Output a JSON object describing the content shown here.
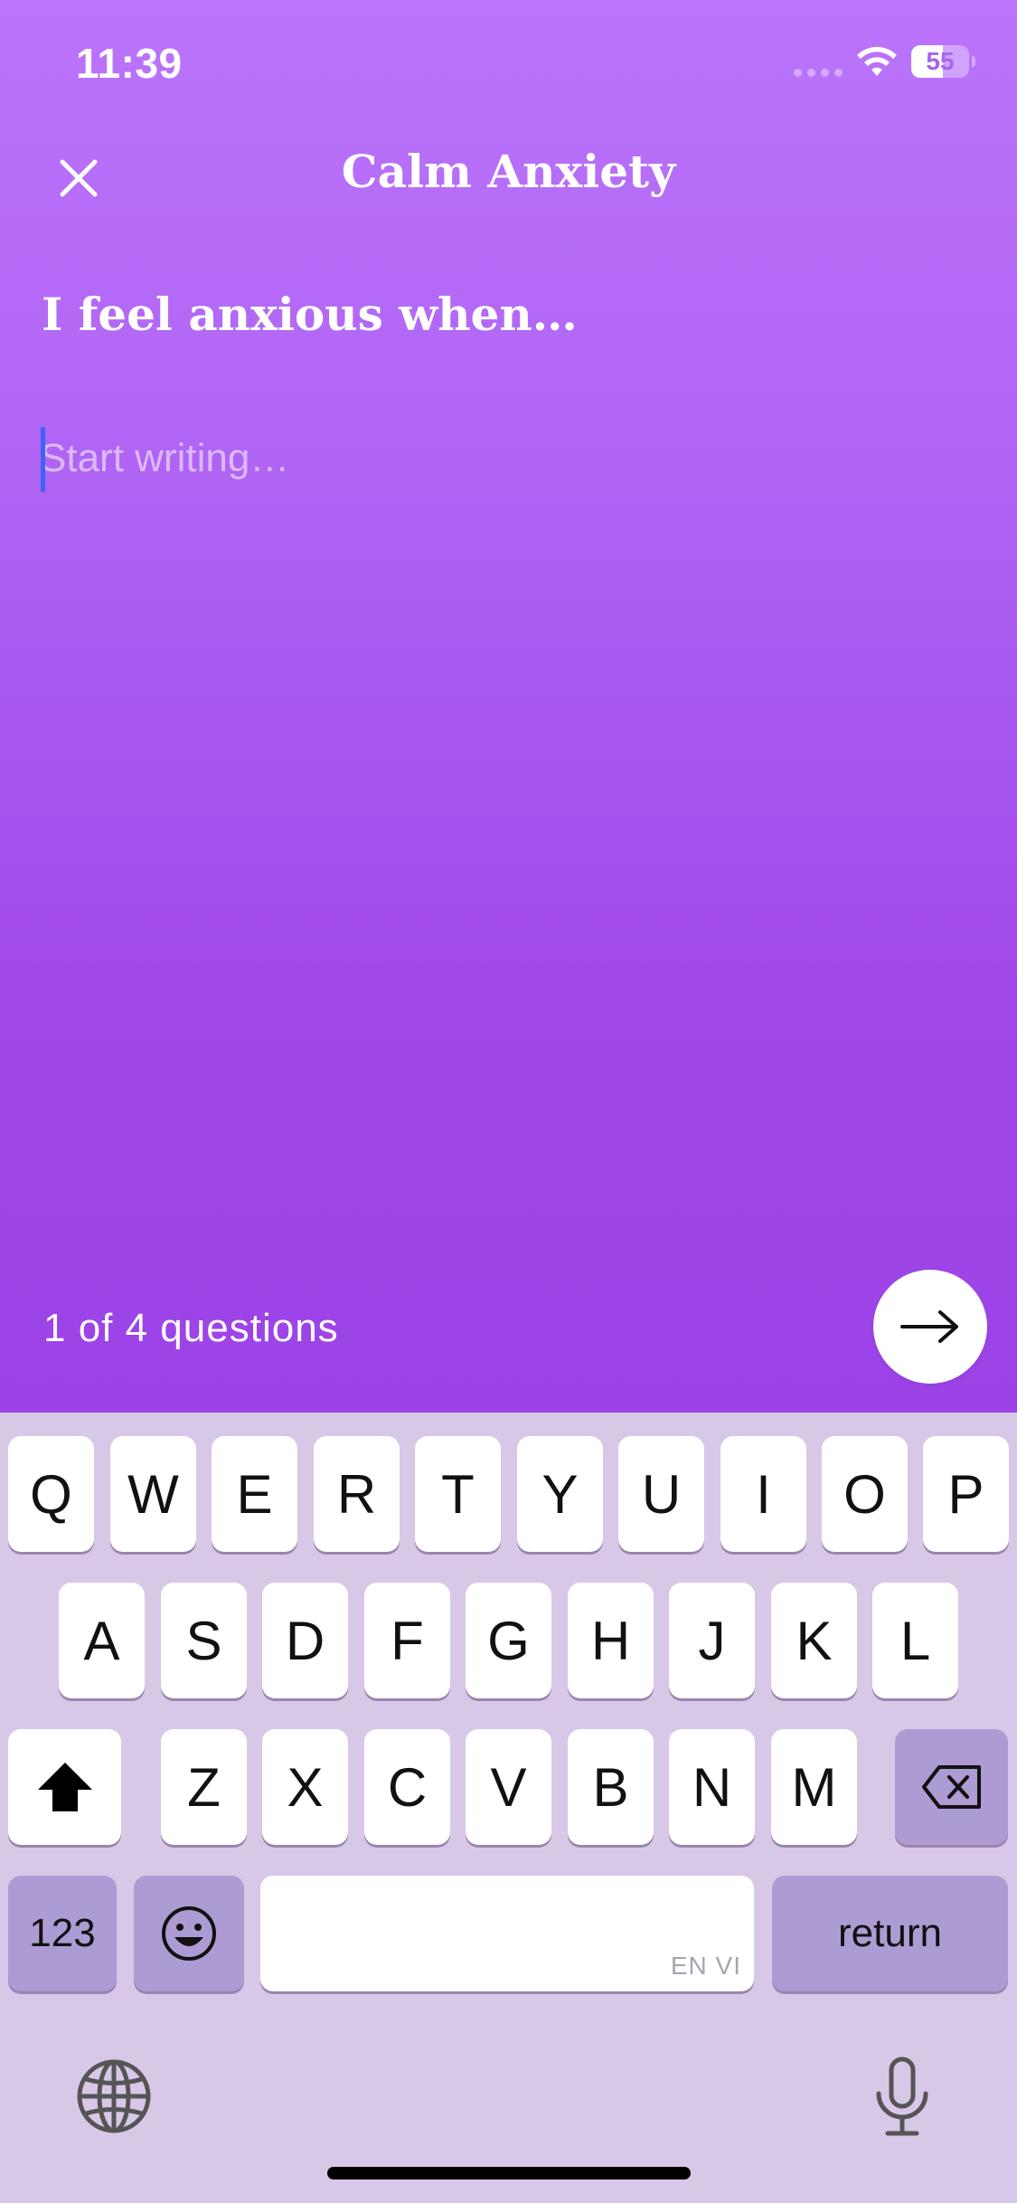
{
  "status_bar": {
    "time": "11:39",
    "battery": "55",
    "wifi_icon": "wifi-icon",
    "battery_icon": "battery-icon"
  },
  "header": {
    "title": "Calm Anxiety",
    "close_icon": "close-icon"
  },
  "prompt": "I feel anxious when…",
  "editor": {
    "placeholder": "Start writing…",
    "value": ""
  },
  "footer": {
    "progress_text": "1 of 4 questions",
    "next_icon": "arrow-right-icon"
  },
  "keyboard": {
    "row1": [
      "Q",
      "W",
      "E",
      "R",
      "T",
      "Y",
      "U",
      "I",
      "O",
      "P"
    ],
    "row2": [
      "A",
      "S",
      "D",
      "F",
      "G",
      "H",
      "J",
      "K",
      "L"
    ],
    "row3": [
      "Z",
      "X",
      "C",
      "V",
      "B",
      "N",
      "M"
    ],
    "numbers_label": "123",
    "space_language": "EN VI",
    "return_label": "return",
    "shift_icon": "shift-icon",
    "delete_icon": "delete-icon",
    "emoji_icon": "emoji-icon",
    "globe_icon": "globe-icon",
    "mic_icon": "microphone-icon"
  },
  "colors": {
    "gradient_top": "#bb74fb",
    "gradient_bottom": "#9c43e7",
    "keyboard_bg": "#d8c8e8",
    "dark_key": "#ad9bd3",
    "cursor": "#3d63f5"
  }
}
